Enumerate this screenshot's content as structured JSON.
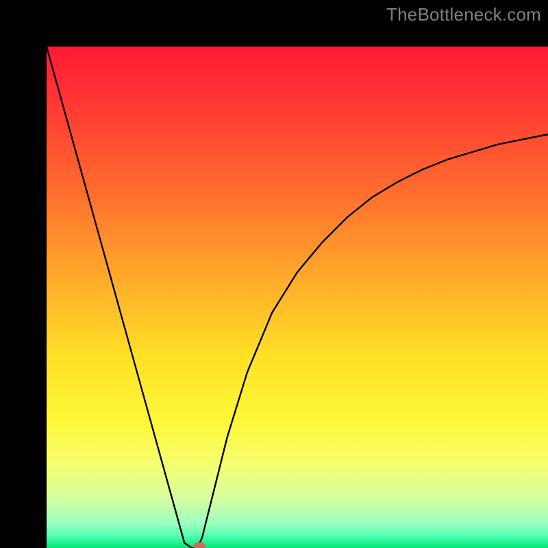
{
  "watermark": "TheBottleneck.com",
  "chart_data": {
    "type": "line",
    "title": "",
    "xlabel": "",
    "ylabel": "",
    "xlim": [
      0,
      1
    ],
    "ylim": [
      0,
      1
    ],
    "background": {
      "type": "vertical-gradient",
      "stops": [
        {
          "pos": 0.0,
          "color": "#ff1a33"
        },
        {
          "pos": 0.12,
          "color": "#ff3a33"
        },
        {
          "pos": 0.28,
          "color": "#ff6a2e"
        },
        {
          "pos": 0.45,
          "color": "#ffa62a"
        },
        {
          "pos": 0.62,
          "color": "#ffe126"
        },
        {
          "pos": 0.75,
          "color": "#fff83a"
        },
        {
          "pos": 0.83,
          "color": "#f7ff6e"
        },
        {
          "pos": 0.9,
          "color": "#d6ff9e"
        },
        {
          "pos": 0.95,
          "color": "#9dffc0"
        },
        {
          "pos": 0.975,
          "color": "#55ffb4"
        },
        {
          "pos": 1.0,
          "color": "#00e67a"
        }
      ]
    },
    "series": [
      {
        "name": "bottleneck-curve",
        "color": "#000000",
        "x": [
          0.0,
          0.05,
          0.1,
          0.15,
          0.2,
          0.25,
          0.275,
          0.29,
          0.3,
          0.31,
          0.33,
          0.36,
          0.4,
          0.45,
          0.5,
          0.55,
          0.6,
          0.65,
          0.7,
          0.75,
          0.8,
          0.85,
          0.9,
          0.95,
          1.0
        ],
        "y": [
          1.0,
          0.82,
          0.64,
          0.46,
          0.28,
          0.1,
          0.01,
          0.0,
          0.0,
          0.02,
          0.1,
          0.22,
          0.35,
          0.47,
          0.55,
          0.61,
          0.66,
          0.7,
          0.73,
          0.755,
          0.775,
          0.79,
          0.805,
          0.815,
          0.825
        ]
      }
    ],
    "marker": {
      "name": "optimal-point",
      "x": 0.305,
      "y": 0.003,
      "color": "#d06a5a",
      "rx": 0.012,
      "ry": 0.009
    }
  }
}
